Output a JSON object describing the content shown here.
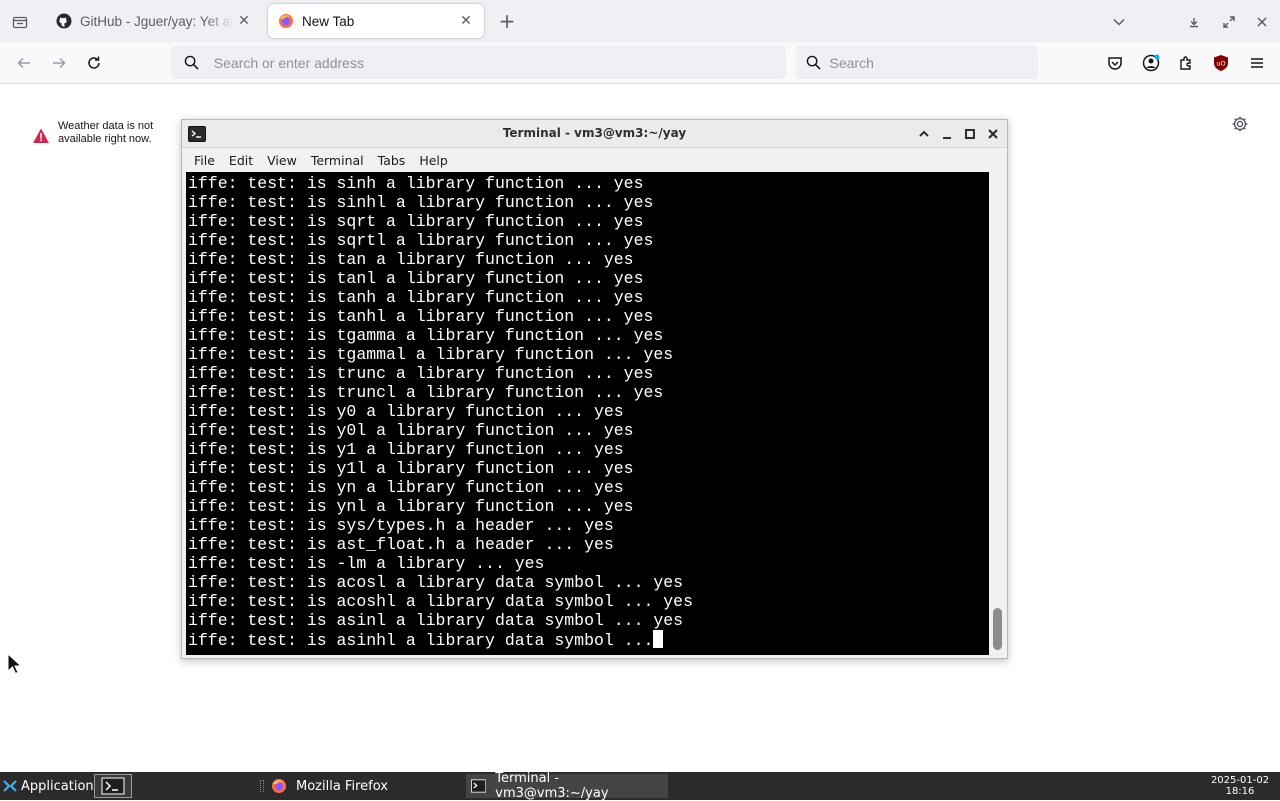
{
  "browser": {
    "tabs": [
      {
        "title": "GitHub - Jguer/yay: Yet another Yogurt - An AUR Helper written in Go",
        "active": false,
        "icon": "github-icon"
      },
      {
        "title": "New Tab",
        "active": true,
        "icon": "firefox-icon"
      }
    ],
    "urlbar_placeholder": "Search or enter address",
    "searchbar_placeholder": "Search"
  },
  "newtab": {
    "weather_message": "Weather data is not available right now."
  },
  "terminal": {
    "title": "Terminal - vm3@vm3:~/yay",
    "menu": [
      "File",
      "Edit",
      "View",
      "Terminal",
      "Tabs",
      "Help"
    ],
    "lines": [
      "iffe: test: is sinh a library function ... yes",
      "iffe: test: is sinhl a library function ... yes",
      "iffe: test: is sqrt a library function ... yes",
      "iffe: test: is sqrtl a library function ... yes",
      "iffe: test: is tan a library function ... yes",
      "iffe: test: is tanl a library function ... yes",
      "iffe: test: is tanh a library function ... yes",
      "iffe: test: is tanhl a library function ... yes",
      "iffe: test: is tgamma a library function ... yes",
      "iffe: test: is tgammal a library function ... yes",
      "iffe: test: is trunc a library function ... yes",
      "iffe: test: is truncl a library function ... yes",
      "iffe: test: is y0 a library function ... yes",
      "iffe: test: is y0l a library function ... yes",
      "iffe: test: is y1 a library function ... yes",
      "iffe: test: is y1l a library function ... yes",
      "iffe: test: is yn a library function ... yes",
      "iffe: test: is ynl a library function ... yes",
      "iffe: test: is sys/types.h a header ... yes",
      "iffe: test: is ast_float.h a header ... yes",
      "iffe: test: is -lm a library ... yes",
      "iffe: test: is acosl a library data symbol ... yes",
      "iffe: test: is acoshl a library data symbol ... yes",
      "iffe: test: is asinl a library data symbol ... yes"
    ],
    "current_line": "iffe: test: is asinhl a library data symbol ...",
    "colors": {
      "background": "#000000",
      "foreground": "#ffffff"
    }
  },
  "taskbar": {
    "applications_label": "Applications",
    "tasks": [
      {
        "label": "Mozilla Firefox",
        "icon": "firefox-icon"
      },
      {
        "label": "Terminal - vm3@vm3:~/yay",
        "icon": "terminal-icon"
      }
    ],
    "date": "2025-01-02",
    "time": "18:16"
  }
}
